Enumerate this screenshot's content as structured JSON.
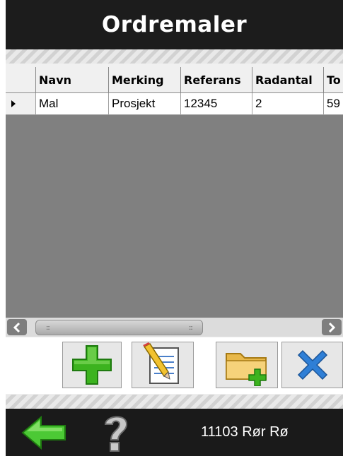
{
  "header": {
    "title": "Ordremaler"
  },
  "grid": {
    "columns": [
      {
        "label": "Navn"
      },
      {
        "label": "Merking"
      },
      {
        "label": "Referans"
      },
      {
        "label": "Radantal"
      },
      {
        "label": "To"
      }
    ],
    "rows": [
      {
        "cells": [
          "Mal",
          "Prosjekt",
          "12345",
          "2",
          "59"
        ]
      }
    ]
  },
  "toolbar": {
    "buttons": [
      {
        "icon": "plus-icon"
      },
      {
        "icon": "edit-document-icon"
      },
      {
        "icon": "new-folder-icon"
      },
      {
        "icon": "close-icon"
      }
    ]
  },
  "bottom": {
    "back_icon": "back-arrow-icon",
    "help_icon": "question-icon",
    "status": "11103 Rør Rø"
  },
  "colors": {
    "header_bg": "#1c1c1c",
    "grid_bg": "#808080",
    "green": "#3cb31f",
    "blue": "#2f7fd6"
  }
}
